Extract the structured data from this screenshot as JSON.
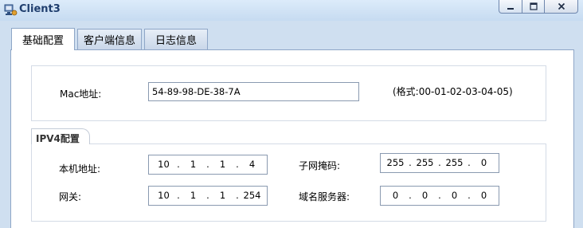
{
  "window": {
    "title": "Client3",
    "icon": "client-app-icon",
    "controls": [
      "minimize-icon",
      "maximize-icon",
      "close-icon"
    ]
  },
  "tabs": [
    {
      "label": "基础配置",
      "active": true
    },
    {
      "label": "客户端信息",
      "active": false
    },
    {
      "label": "日志信息",
      "active": false
    }
  ],
  "mac": {
    "label": "Mac地址:",
    "value": "54-89-98-DE-38-7A",
    "format_hint": "(格式:00-01-02-03-04-05)"
  },
  "ipv4": {
    "section_label": "IPV4配置",
    "local_ip": {
      "label": "本机地址:",
      "octets": [
        "10",
        "1",
        "1",
        "4"
      ]
    },
    "subnet_mask": {
      "label": "子网掩码:",
      "octets": [
        "255",
        "255",
        "255",
        "0"
      ]
    },
    "gateway": {
      "label": "网关:",
      "octets": [
        "10",
        "1",
        "1",
        "254"
      ]
    },
    "dns": {
      "label": "域名服务器:",
      "octets": [
        "0",
        "0",
        "0",
        "0"
      ]
    }
  },
  "colors": {
    "titlebar": "#c6dbf1",
    "title_text": "#1f3e6e",
    "border": "#8ea6c7"
  }
}
